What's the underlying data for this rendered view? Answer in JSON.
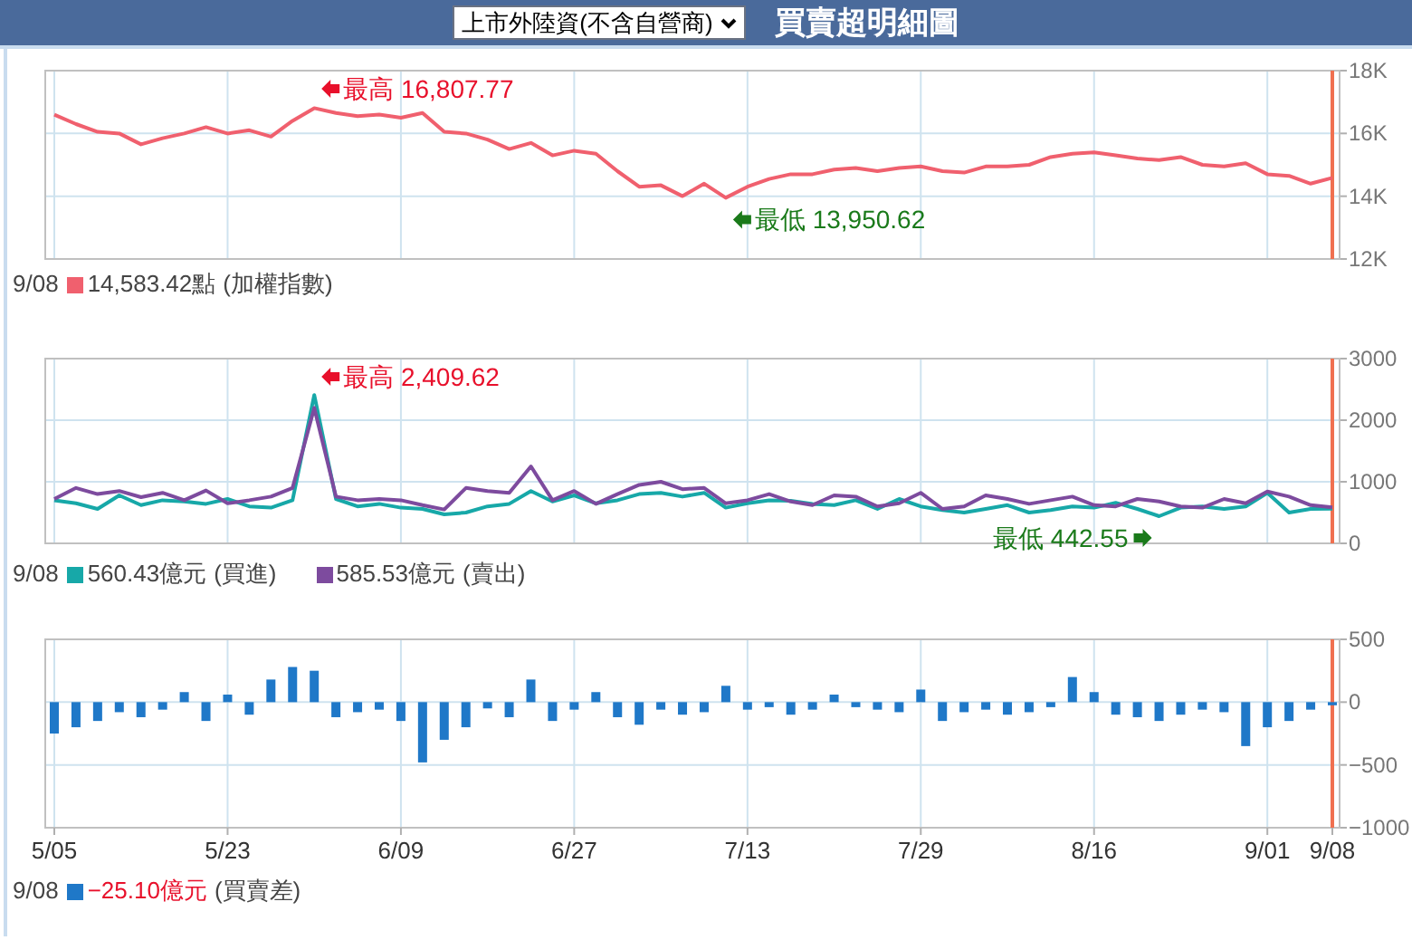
{
  "header": {
    "dropdown": "上市外陸資(不含自營商)",
    "title": "買賣超明細圖"
  },
  "charts": [
    {
      "chart_data": {
        "type": "line",
        "grid": true,
        "ylim": [
          12000,
          18000
        ],
        "yticks": [
          {
            "value": 12000,
            "label": "12K"
          },
          {
            "value": 14000,
            "label": "14K"
          },
          {
            "value": 16000,
            "label": "16K"
          },
          {
            "value": 18000,
            "label": "18K"
          }
        ],
        "series": [
          {
            "color": "#f0606e",
            "values": [
              16600,
              16300,
              16050,
              16000,
              15650,
              15850,
              16000,
              16200,
              16000,
              16100,
              15900,
              16400,
              16807.77,
              16650,
              16550,
              16600,
              16500,
              16650,
              16050,
              16000,
              15800,
              15500,
              15700,
              15300,
              15450,
              15350,
              14800,
              14300,
              14350,
              14000,
              14400,
              13950.62,
              14300,
              14550,
              14700,
              14700,
              14850,
              14900,
              14800,
              14900,
              14950,
              14800,
              14750,
              14950,
              14950,
              15000,
              15250,
              15350,
              15400,
              15300,
              15200,
              15150,
              15250,
              15000,
              14950,
              15050,
              14700,
              14650,
              14400,
              14583.42
            ]
          }
        ],
        "annotations": [
          "最高 16,807.77",
          "最低 13,950.62"
        ]
      },
      "legend": {
        "date": "9/08",
        "items": [
          {
            "value": "14,583.42點",
            "label": "(加權指數)",
            "negative": false
          }
        ]
      }
    },
    {
      "chart_data": {
        "type": "line",
        "grid": true,
        "ylim": [
          0,
          3000
        ],
        "yticks": [
          0,
          1000,
          2000,
          3000
        ],
        "series": [
          {
            "color": "#17a8a8",
            "values": [
              700,
              650,
              560,
              780,
              620,
              700,
              680,
              640,
              720,
              600,
              580,
              700,
              2409.62,
              720,
              600,
              640,
              580,
              560,
              470,
              500,
              600,
              640,
              850,
              680,
              780,
              650,
              700,
              800,
              820,
              760,
              820,
              580,
              650,
              700,
              690,
              640,
              620,
              700,
              560,
              720,
              600,
              540,
              500,
              560,
              620,
              500,
              540,
              600,
              580,
              660,
              560,
              442.55,
              580,
              600,
              560,
              600,
              820,
              500,
              560,
              560.43
            ]
          },
          {
            "color": "#7d4b9e",
            "values": [
              720,
              900,
              800,
              850,
              750,
              820,
              700,
              860,
              650,
              700,
              760,
              900,
              2200,
              760,
              700,
              720,
              700,
              620,
              550,
              900,
              850,
              820,
              1250,
              700,
              850,
              640,
              800,
              950,
              1000,
              880,
              900,
              650,
              700,
              800,
              680,
              620,
              780,
              760,
              600,
              650,
              820,
              560,
              600,
              780,
              720,
              640,
              700,
              760,
              620,
              600,
              720,
              680,
              600,
              580,
              720,
              650,
              840,
              760,
              620,
              585.53
            ]
          }
        ],
        "annotations": [
          "最高 2,409.62",
          "最低 442.55"
        ]
      },
      "legend": {
        "date": "9/08",
        "items": [
          {
            "value": "560.43億元",
            "label": "(買進)",
            "negative": false
          },
          {
            "value": "585.53億元",
            "label": "(賣出)",
            "negative": false
          }
        ]
      }
    },
    {
      "chart_data": {
        "type": "bar",
        "grid": true,
        "ylim": [
          -1000,
          500
        ],
        "yticks": [
          {
            "value": -1000,
            "label": "−1000"
          },
          {
            "value": -500,
            "label": "−500"
          },
          0,
          500
        ],
        "categories": [
          "5/05",
          null,
          null,
          null,
          null,
          null,
          null,
          null,
          "5/23",
          null,
          null,
          null,
          null,
          null,
          null,
          null,
          "6/09",
          null,
          null,
          null,
          null,
          null,
          null,
          null,
          "6/27",
          null,
          null,
          null,
          null,
          null,
          null,
          null,
          "7/13",
          null,
          null,
          null,
          null,
          null,
          null,
          null,
          "7/29",
          null,
          null,
          null,
          null,
          null,
          null,
          null,
          "8/16",
          null,
          null,
          null,
          null,
          null,
          null,
          null,
          "9/01",
          null,
          null,
          "9/08"
        ],
        "series": [
          {
            "color": "#1f78c8",
            "values": [
              -250,
              -200,
              -150,
              -80,
              -120,
              -60,
              80,
              -150,
              60,
              -100,
              180,
              280,
              250,
              -120,
              -80,
              -60,
              -150,
              -480,
              -300,
              -200,
              -50,
              -120,
              180,
              -150,
              -60,
              80,
              -120,
              -180,
              -60,
              -100,
              -80,
              130,
              -60,
              -40,
              -100,
              -60,
              60,
              -40,
              -60,
              -80,
              100,
              -150,
              -80,
              -60,
              -100,
              -80,
              -40,
              200,
              80,
              -100,
              -120,
              -150,
              -100,
              -60,
              -80,
              -350,
              -200,
              -150,
              -60,
              -25.1
            ]
          }
        ]
      },
      "legend": {
        "date": "9/08",
        "items": [
          {
            "value": "−25.10億元",
            "label": "(買賣差)",
            "negative": true
          }
        ]
      }
    }
  ]
}
